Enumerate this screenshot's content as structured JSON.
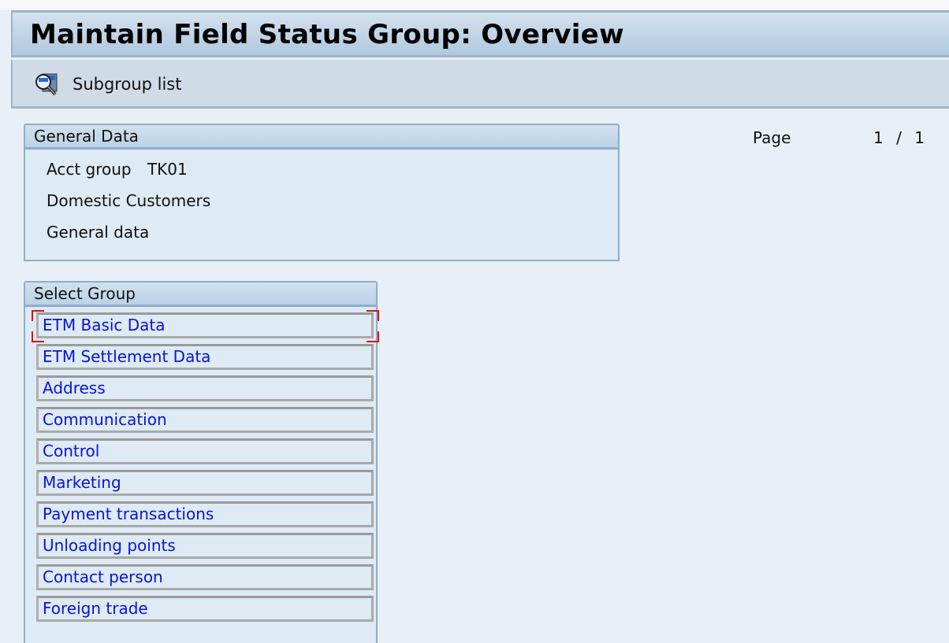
{
  "title": "Maintain Field Status Group: Overview",
  "toolbar": {
    "subgroup_list": {
      "label": "Subgroup list",
      "icon": "search-list-icon"
    }
  },
  "general_data": {
    "header": "General Data",
    "acct_group_label": "Acct group",
    "acct_group_value": "TK01",
    "description": "Domestic Customers",
    "section": "General data"
  },
  "pagination": {
    "label": "Page",
    "current": "1",
    "separator": "/",
    "total": "1"
  },
  "select_group": {
    "header": "Select Group",
    "focused_index": 0,
    "items": [
      {
        "label": "ETM Basic Data"
      },
      {
        "label": "ETM Settlement Data"
      },
      {
        "label": "Address"
      },
      {
        "label": "Communication"
      },
      {
        "label": "Control"
      },
      {
        "label": "Marketing"
      },
      {
        "label": "Payment transactions"
      },
      {
        "label": "Unloading points"
      },
      {
        "label": "Contact person"
      },
      {
        "label": "Foreign trade"
      }
    ]
  },
  "colors": {
    "link": "#0a14d8",
    "focus": "#e01010",
    "panel_border": "#8eaecd"
  }
}
